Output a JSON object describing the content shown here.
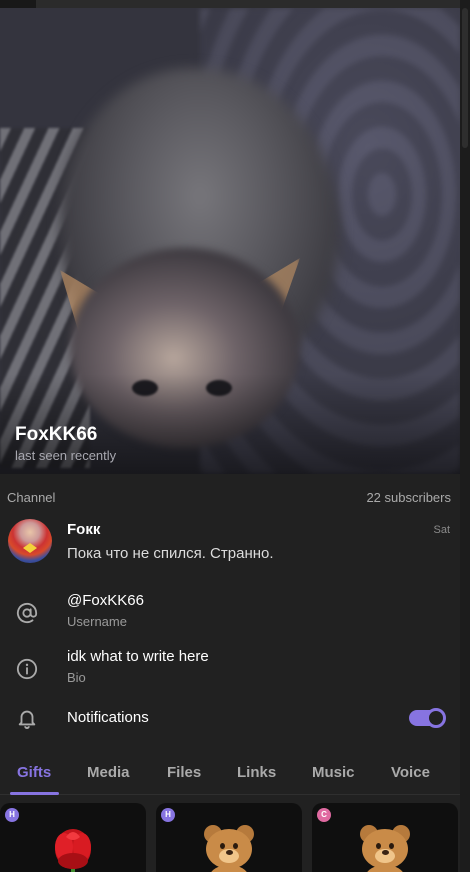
{
  "profile": {
    "name": "FoxKK66",
    "status": "last seen recently"
  },
  "channel_section": {
    "label": "Channel",
    "subscribers": "22 subscribers",
    "channel": {
      "name": "Fокк",
      "date": "Sat",
      "last_message": "Пока что не спился. Странно."
    }
  },
  "info": {
    "username": {
      "value": "@FoxKK66",
      "label": "Username",
      "icon": "at-icon"
    },
    "bio": {
      "value": "idk what to write here",
      "label": "Bio",
      "icon": "info-icon"
    }
  },
  "notifications": {
    "label": "Notifications",
    "enabled": true,
    "icon": "bell-icon"
  },
  "tabs": [
    {
      "label": "Gifts",
      "active": true
    },
    {
      "label": "Media",
      "active": false
    },
    {
      "label": "Files",
      "active": false
    },
    {
      "label": "Links",
      "active": false
    },
    {
      "label": "Music",
      "active": false
    },
    {
      "label": "Voice",
      "active": false
    }
  ],
  "gifts": [
    {
      "badge": "H",
      "icon": "rose-icon"
    },
    {
      "badge": "H",
      "icon": "teddy-bear-icon"
    },
    {
      "badge": "C",
      "icon": "teddy-bear-icon"
    }
  ],
  "colors": {
    "accent": "#8774e1",
    "background": "#212121",
    "secondary_text": "#aaaaaa"
  }
}
